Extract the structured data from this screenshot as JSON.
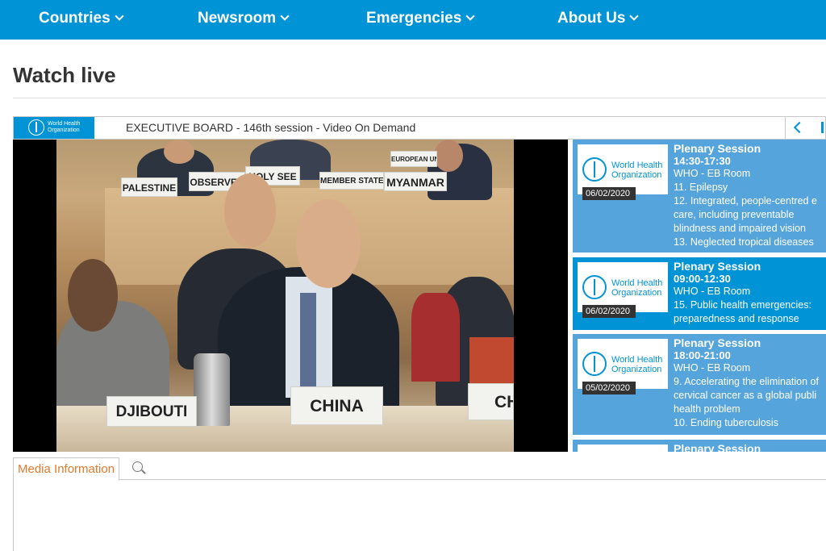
{
  "nav": {
    "items": [
      {
        "label": "Countries"
      },
      {
        "label": "Newsroom"
      },
      {
        "label": "Emergencies"
      },
      {
        "label": "About Us"
      }
    ]
  },
  "page": {
    "title": "Watch live"
  },
  "player": {
    "logo_text_line1": "World Health",
    "logo_text_line2": "Organization",
    "title": "EXECUTIVE BOARD - 146th session - Video On Demand"
  },
  "video": {
    "nameplates": [
      "PALESTINE",
      "OBSERVER",
      "HOLY SEE",
      "MEMBER STATES",
      "MYANMAR",
      "EUROPEAN UNI",
      "DJIBOUTI",
      "CHINA",
      "CH"
    ]
  },
  "playlist": {
    "thumb_text_line1": "World Health",
    "thumb_text_line2": "Organization",
    "items": [
      {
        "title": "Plenary Session",
        "time": "14:30-17:30",
        "date": "06/02/2020",
        "lines": [
          "WHO - EB Room",
          "11. Epilepsy",
          "12. Integrated, people-centred e",
          "care, including preventable",
          "blindness and impaired vision",
          "13. Neglected tropical diseases"
        ]
      },
      {
        "title": "Plenary Session",
        "time": "09:00-12:30",
        "date": "06/02/2020",
        "lines": [
          "WHO - EB Room",
          "15. Public health emergencies:",
          "preparedness and response"
        ]
      },
      {
        "title": "Plenary Session",
        "time": "18:00-21:00",
        "date": "05/02/2020",
        "lines": [
          "WHO - EB Room",
          "9. Accelerating the elimination of",
          "cervical cancer as a global publi",
          "health problem",
          "10. Ending tuberculosis"
        ]
      },
      {
        "title": "Plenary Session",
        "time": "",
        "date": "",
        "lines": []
      }
    ]
  },
  "tabs": {
    "media_information": "Media Information"
  },
  "colors": {
    "brand_blue": "#0093d5",
    "playlist_blue": "#56a4dc",
    "tab_orange": "#e07a2e"
  }
}
